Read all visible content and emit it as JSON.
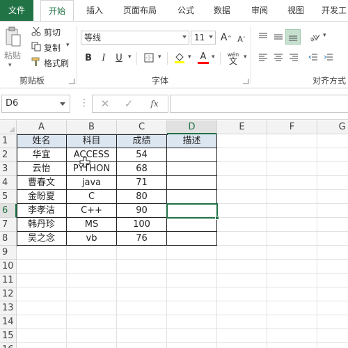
{
  "ribbon_tabs": [
    "文件",
    "开始",
    "插入",
    "页面布局",
    "公式",
    "数据",
    "审阅",
    "视图",
    "开发工"
  ],
  "clipboard": {
    "paste_label": "粘贴",
    "cut_label": "剪切",
    "copy_label": "复制",
    "format_painter_label": "格式刷",
    "group_label": "剪贴板"
  },
  "font": {
    "font_name": "等线",
    "font_size": "11",
    "group_label": "字体",
    "bold": "B",
    "italic": "I",
    "underline": "U",
    "grow": "A",
    "shrink": "A",
    "phonetic": "wén"
  },
  "alignment": {
    "group_label": "对齐方式"
  },
  "formula_bar": {
    "name_box": "D6",
    "fx_label": "fx",
    "formula_value": ""
  },
  "columns": [
    "A",
    "B",
    "C",
    "D",
    "E",
    "F",
    "G"
  ],
  "rows": [
    "1",
    "2",
    "3",
    "4",
    "5",
    "6",
    "7",
    "8",
    "9",
    "10",
    "11",
    "12",
    "13",
    "14",
    "15",
    "16"
  ],
  "table": {
    "headers": [
      "姓名",
      "科目",
      "成绩",
      "描述"
    ],
    "rows": [
      [
        "华宜",
        "ACCESS",
        "54",
        ""
      ],
      [
        "云怡",
        "PYTHON",
        "68",
        ""
      ],
      [
        "曹春文",
        "java",
        "71",
        ""
      ],
      [
        "金盼夏",
        "C",
        "80",
        ""
      ],
      [
        "李孝洁",
        "C++",
        "90",
        ""
      ],
      [
        "韩丹珍",
        "MS",
        "100",
        ""
      ],
      [
        "吴之念",
        "vb",
        "76",
        ""
      ]
    ]
  },
  "selected_cell": "D6",
  "colors": {
    "accent": "#217346",
    "header_fill": "#dce6f1",
    "font_color_bar": "#ff0000"
  }
}
